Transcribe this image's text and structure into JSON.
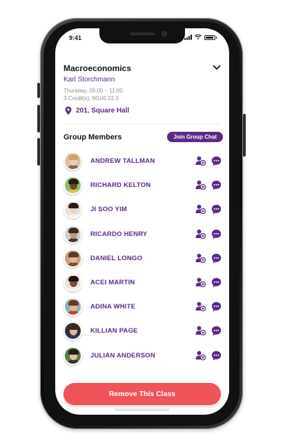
{
  "status_bar": {
    "time": "9:41"
  },
  "course": {
    "title": "Macroeconomics",
    "instructor": "Karl Storchmann",
    "schedule_line1": "Thursday, 09:00 ~ 11:00",
    "schedule_line2": "3 Credit(s), M100.22.3",
    "location": "201, Square Hall"
  },
  "group": {
    "title": "Group Members",
    "join_label": "Join Group Chat",
    "members": [
      {
        "name": "ANDREW TALLMAN",
        "bg": "#d9c2a6",
        "skin": "#f1cfae",
        "hair": "#c9a56a",
        "shirt": "#7a6a55"
      },
      {
        "name": "RICHARD KELTON",
        "bg": "#8fbf6a",
        "skin": "#6b4530",
        "hair": "#2a1a12",
        "shirt": "#e2c34a"
      },
      {
        "name": "JI SOO YIM",
        "bg": "#e8e1dc",
        "skin": "#f0d3bd",
        "hair": "#2b1b16",
        "shirt": "#f4f0ec"
      },
      {
        "name": "RICARDO HENRY",
        "bg": "#cfcfcf",
        "skin": "#c59a7e",
        "hair": "#3a2a22",
        "shirt": "#3b3b3b"
      },
      {
        "name": "DANIEL LONGO",
        "bg": "#c8a27a",
        "skin": "#e4b894",
        "hair": "#5a3a22",
        "shirt": "#7a5030"
      },
      {
        "name": "ACEI MARTIN",
        "bg": "#e7e1d8",
        "skin": "#7a4a30",
        "hair": "#1d120d",
        "shirt": "#f3efe8"
      },
      {
        "name": "ADINA WHITE",
        "bg": "#8fb2b8",
        "skin": "#e0b495",
        "hair": "#6a3a22",
        "shirt": "#b54a3a"
      },
      {
        "name": "KILLIAN PAGE",
        "bg": "#2d3142",
        "skin": "#e2b896",
        "hair": "#3a2a1e",
        "shirt": "#2a3a5a"
      },
      {
        "name": "JULIAN ANDERSON",
        "bg": "#5b7a4a",
        "skin": "#e8c0a0",
        "hair": "#2a1e18",
        "shirt": "#2e2e2e"
      }
    ]
  },
  "actions": {
    "remove_label": "Remove This Class"
  },
  "colors": {
    "accent": "#5b2a86",
    "danger": "#f05359"
  },
  "icons": [
    "chevron-down-icon",
    "location-pin-icon",
    "add-member-icon",
    "chat-bubble-icon",
    "signal-icon",
    "wifi-icon",
    "battery-icon"
  ]
}
